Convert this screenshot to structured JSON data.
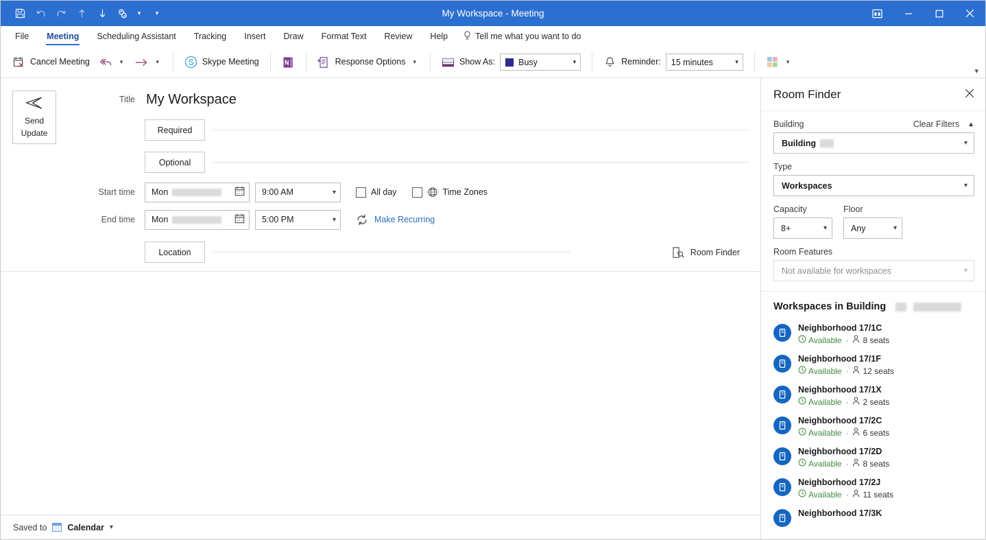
{
  "titlebar": {
    "title": "My Workspace - Meeting",
    "qat": [
      {
        "name": "save-icon",
        "label": "Save"
      },
      {
        "name": "undo-icon",
        "label": "Undo"
      },
      {
        "name": "redo-icon",
        "label": "Redo"
      },
      {
        "name": "previous-item-icon",
        "label": "Previous Item"
      },
      {
        "name": "next-item-icon",
        "label": "Next Item"
      },
      {
        "name": "skype-icon",
        "label": "Skype Meeting"
      }
    ],
    "window_controls": {
      "ribbon_display": "Ribbon Display Options",
      "minimize": "Minimize",
      "maximize": "Maximize",
      "close": "Close"
    }
  },
  "tabs": [
    {
      "label": "File",
      "active": false
    },
    {
      "label": "Meeting",
      "active": true
    },
    {
      "label": "Scheduling Assistant",
      "active": false
    },
    {
      "label": "Tracking",
      "active": false
    },
    {
      "label": "Insert",
      "active": false
    },
    {
      "label": "Draw",
      "active": false
    },
    {
      "label": "Format Text",
      "active": false
    },
    {
      "label": "Review",
      "active": false
    },
    {
      "label": "Help",
      "active": false
    }
  ],
  "tell_me": "Tell me what you want to do",
  "ribbon": {
    "cancel_meeting": "Cancel Meeting",
    "skype_meeting": "Skype Meeting",
    "onenote": "Meeting Notes",
    "response_options": "Response Options",
    "show_as_label": "Show As:",
    "show_as_value": "Busy",
    "show_as_color": "#2b2b8f",
    "reminder_label": "Reminder:",
    "reminder_value": "15 minutes",
    "categorize": "Categorize"
  },
  "form": {
    "send_update": "Send\nUpdate",
    "send_update_line1": "Send",
    "send_update_line2": "Update",
    "title_label": "Title",
    "title_value": "My Workspace",
    "required_label": "Required",
    "required_value": "",
    "optional_label": "Optional",
    "optional_value": "",
    "start_time_label": "Start time",
    "end_time_label": "End time",
    "start_date_day": "Mon",
    "start_date_value": "",
    "end_date_day": "Mon",
    "end_date_value": "",
    "start_time_value": "9:00 AM",
    "end_time_value": "5:00 PM",
    "all_day_label": "All day",
    "all_day_checked": false,
    "time_zones_label": "Time Zones",
    "time_zones_checked": false,
    "make_recurring_label": "Make Recurring",
    "location_label": "Location",
    "location_value": "",
    "room_finder_label": "Room Finder"
  },
  "statusbar": {
    "saved_to": "Saved to",
    "folder": "Calendar"
  },
  "room_finder": {
    "title": "Room Finder",
    "close": "Close",
    "building_label": "Building",
    "clear_filters": "Clear Filters",
    "building_value": "Building",
    "type_label": "Type",
    "type_value": "Workspaces",
    "capacity_label": "Capacity",
    "capacity_value": "8+",
    "floor_label": "Floor",
    "floor_value": "Any",
    "room_features_label": "Room Features",
    "room_features_value": "Not available for workspaces",
    "list_title": "Workspaces in Building",
    "workspaces": [
      {
        "name": "Neighborhood 17/1C",
        "status": "Available",
        "seats": "8 seats"
      },
      {
        "name": "Neighborhood 17/1F",
        "status": "Available",
        "seats": "12 seats"
      },
      {
        "name": "Neighborhood 17/1X",
        "status": "Available",
        "seats": "2 seats"
      },
      {
        "name": "Neighborhood 17/2C",
        "status": "Available",
        "seats": "6 seats"
      },
      {
        "name": "Neighborhood 17/2D",
        "status": "Available",
        "seats": "8 seats"
      },
      {
        "name": "Neighborhood 17/2J",
        "status": "Available",
        "seats": "11 seats"
      },
      {
        "name": "Neighborhood 17/3K",
        "status": "",
        "seats": ""
      }
    ]
  },
  "colors": {
    "titlebar": "#2b6fd0",
    "accent": "#2b6fd0",
    "available": "#3f8a3f",
    "avatar": "#1566c0",
    "link": "#2a6fc0"
  }
}
